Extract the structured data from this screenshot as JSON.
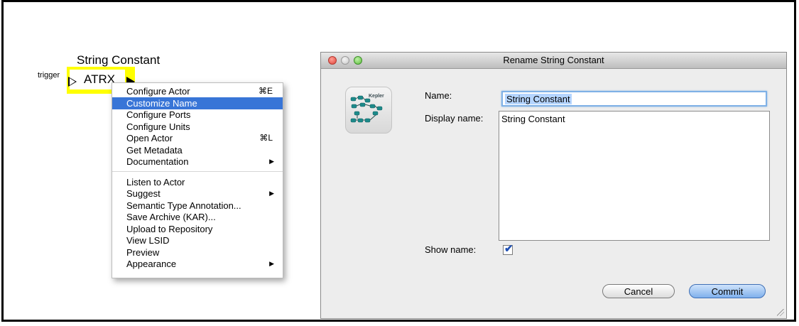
{
  "actor": {
    "title": "String Constant",
    "trigger_label": "trigger",
    "label": "ATRX",
    "highlight_color": "#ffff00"
  },
  "context_menu": {
    "selected_color": "#3875d7",
    "items": [
      {
        "label": "Configure Actor",
        "shortcut": "⌘E",
        "submenu": false
      },
      {
        "label": "Customize Name",
        "shortcut": "",
        "submenu": false,
        "selected": true
      },
      {
        "label": "Configure Ports",
        "shortcut": "",
        "submenu": false
      },
      {
        "label": "Configure Units",
        "shortcut": "",
        "submenu": false
      },
      {
        "label": "Open Actor",
        "shortcut": "⌘L",
        "submenu": false
      },
      {
        "label": "Get Metadata",
        "shortcut": "",
        "submenu": false
      },
      {
        "label": "Documentation",
        "shortcut": "",
        "submenu": true
      },
      {
        "label": "Listen to Actor",
        "shortcut": "",
        "submenu": false
      },
      {
        "label": "Suggest",
        "shortcut": "",
        "submenu": true
      },
      {
        "label": "Semantic Type Annotation...",
        "shortcut": "",
        "submenu": false
      },
      {
        "label": "Save Archive (KAR)...",
        "shortcut": "",
        "submenu": false
      },
      {
        "label": "Upload to Repository",
        "shortcut": "",
        "submenu": false
      },
      {
        "label": "View LSID",
        "shortcut": "",
        "submenu": false
      },
      {
        "label": "Preview",
        "shortcut": "",
        "submenu": false
      },
      {
        "label": "Appearance",
        "shortcut": "",
        "submenu": true
      }
    ],
    "submenu_arrow": "▶"
  },
  "dialog": {
    "title": "Rename String Constant",
    "icon_text": "Kepler",
    "name_label": "Name:",
    "name_value": "String Constant",
    "display_name_label": "Display name:",
    "display_name_value": "String Constant",
    "show_name_label": "Show name:",
    "show_name_checked": true,
    "check_glyph": "✔",
    "cancel_label": "Cancel",
    "commit_label": "Commit"
  }
}
